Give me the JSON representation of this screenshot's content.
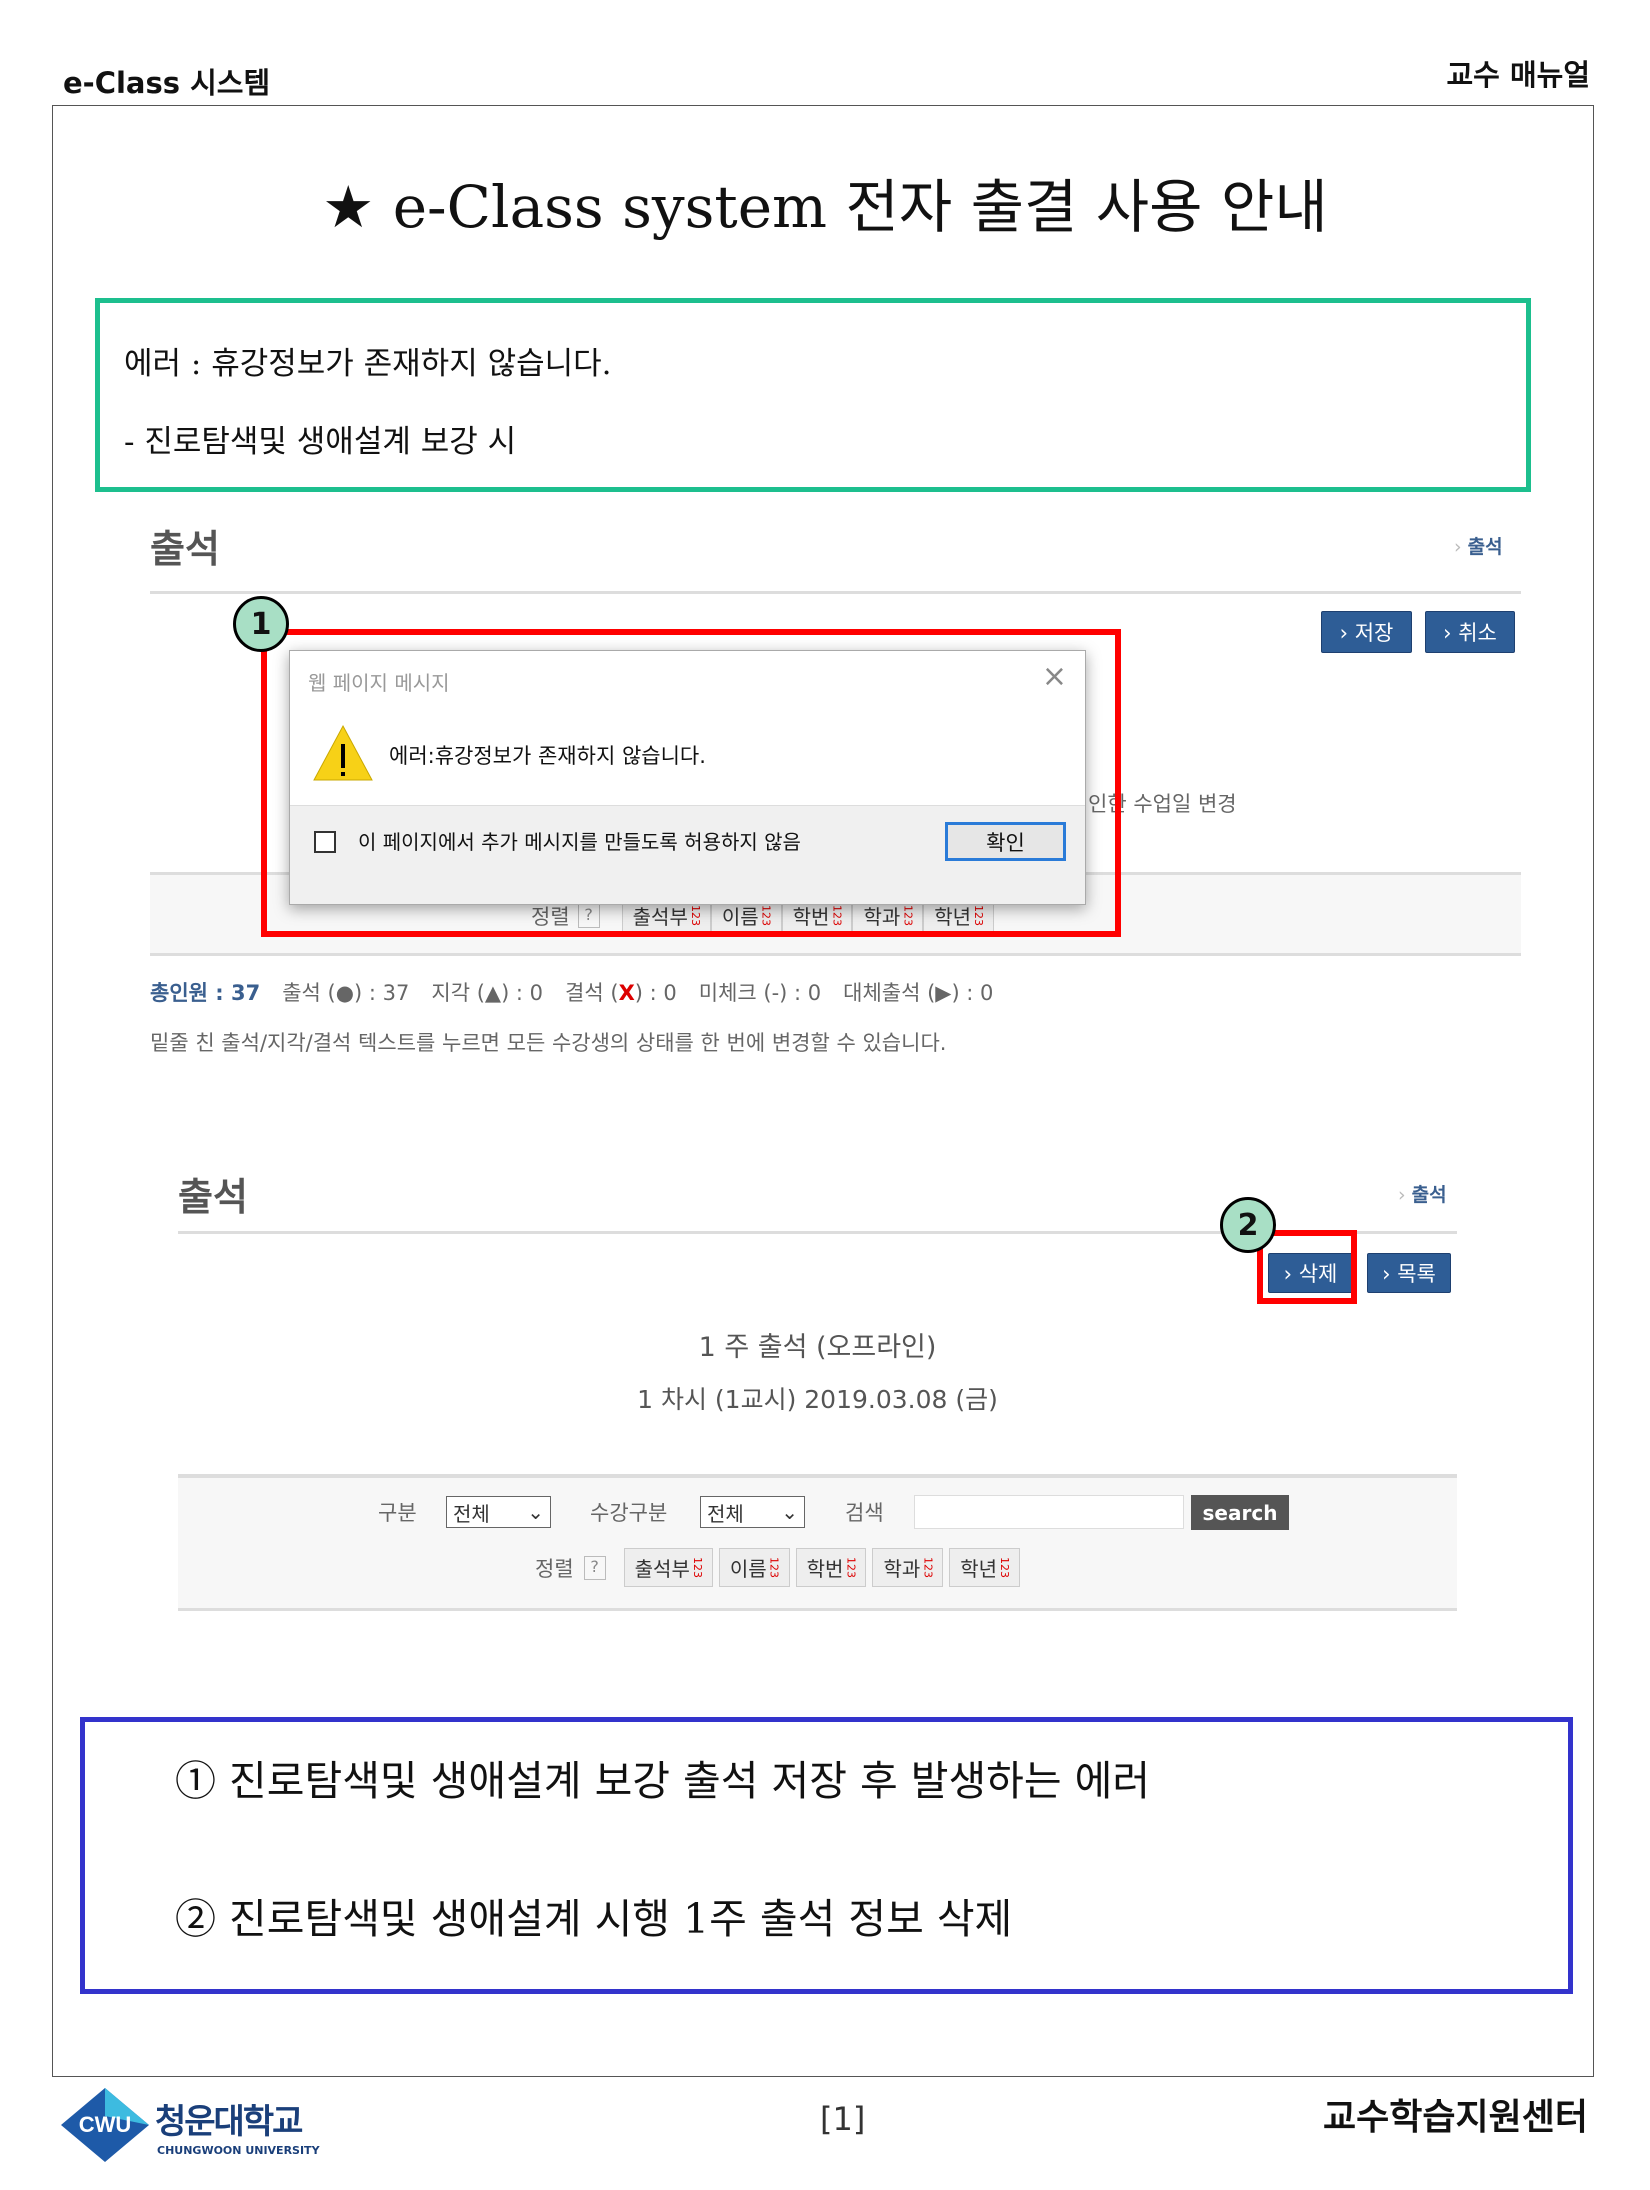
{
  "header": {
    "left": "e-Class 시스템",
    "right": "교수 매뉴얼"
  },
  "title": "★ e-Class system 전자 출결 사용 안내",
  "note": {
    "line1": "에러 : 휴강정보가 존재하지  않습니다.",
    "line2": "- 진로탐색및 생애설계 보강 시"
  },
  "screen1": {
    "heading": "출석",
    "breadcrumb": "출석",
    "save": "› 저장",
    "cancel": "› 취소",
    "marker": "1",
    "behind_text": "인한 수업일 변경",
    "dialog": {
      "title": "웹 페이지 메시지",
      "message": "에러:휴강정보가 존재하지 않습니다.",
      "checkbox_label": "이 페이지에서 추가 메시지를 만들도록 허용하지 않음",
      "ok": "확인"
    },
    "sort_label": "정렬",
    "sort_buttons": [
      "출석부",
      "이름",
      "학번",
      "학과",
      "학년"
    ],
    "stats": {
      "total": "총인원 : 37",
      "present": "출석 (●) : 37",
      "late": "지각 (▲) : 0",
      "absent_label": "결석 (",
      "absent_mark": "X",
      "absent_end": ") : 0",
      "unchecked": "미체크 (-) : 0",
      "substitute": "대체출석 (▶) : 0"
    },
    "hint": "밑줄 친 출석/지각/결석 텍스트를 누르면 모든 수강생의 상태를 한 번에 변경할 수 있습니다."
  },
  "screen2": {
    "heading": "출석",
    "breadcrumb": "출석",
    "delete": "› 삭제",
    "list": "› 목록",
    "marker": "2",
    "session_title": "1 주 출석 (오프라인)",
    "session_sub": "1 차시 (1교시)  2019.03.08 (금)",
    "filter": {
      "type_label": "구분",
      "type_value": "전체",
      "enroll_label": "수강구분",
      "enroll_value": "전체",
      "search_label": "검색",
      "search_value": "",
      "search_button": "search"
    },
    "sort_label": "정렬",
    "sort_buttons": [
      "출석부",
      "이름",
      "학번",
      "학과",
      "학년"
    ]
  },
  "explain": {
    "line1": "① 진로탐색및 생애설계 보강 출석 저장 후 발생하는 에러",
    "line2": "② 진로탐색및 생애설계 시행 1주 출석 정보 삭제"
  },
  "footer": {
    "logo_text": "청운대학교",
    "logo_sub": "CHUNGWOON UNIVERSITY",
    "logo_mark": "CWU",
    "page": "[1]",
    "center": "교수학습지원센터"
  },
  "colors": {
    "green_box": "#1dbf8e",
    "red_box": "#ff0000",
    "blue_box": "#3333cc",
    "button": "#2e5d96"
  }
}
